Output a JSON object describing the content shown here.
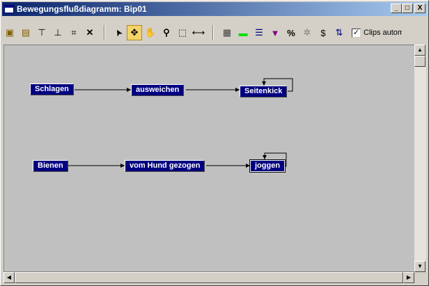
{
  "window": {
    "title": "Bewegungsflußdiagramm: Bip01",
    "buttons": [
      "_",
      "□",
      "X"
    ]
  },
  "toolbar": {
    "tools": [
      {
        "name": "new-layer-icon",
        "glyph": "▣"
      },
      {
        "name": "open-file-icon",
        "glyph": "▤"
      },
      {
        "name": "insert-transition-icon",
        "glyph": "⊤"
      },
      {
        "name": "insert-clip-icon",
        "glyph": "⊥"
      },
      {
        "name": "link-icon",
        "glyph": "⌗"
      },
      {
        "name": "delete-icon",
        "glyph": "✕"
      },
      {
        "name": "select-arrow-icon",
        "glyph": "➤"
      },
      {
        "name": "move-icon",
        "glyph": "✥"
      },
      {
        "name": "pan-hand-icon",
        "glyph": "✋"
      },
      {
        "name": "zoom-icon",
        "glyph": "⚲"
      },
      {
        "name": "zoom-region-icon",
        "glyph": "⬚"
      },
      {
        "name": "zoom-extents-icon",
        "glyph": "⟷"
      },
      {
        "name": "save-icon",
        "glyph": "▦"
      },
      {
        "name": "green-clip-icon",
        "glyph": "▬"
      },
      {
        "name": "list-icon",
        "glyph": "☰"
      },
      {
        "name": "purple-select-icon",
        "glyph": "▼"
      },
      {
        "name": "percent-icon",
        "glyph": "%"
      },
      {
        "name": "settings-icon",
        "glyph": "✲"
      },
      {
        "name": "dollar-icon",
        "glyph": "$"
      },
      {
        "name": "random-icon",
        "glyph": "⇅"
      }
    ],
    "clips_checkbox": {
      "checked": "✓",
      "label": "Clips autom. b"
    }
  },
  "diagram": {
    "nodes": [
      {
        "id": "schlagen",
        "label": "Schlagen"
      },
      {
        "id": "ausweichen",
        "label": "ausweichen"
      },
      {
        "id": "seitenkick",
        "label": "Seitenkick"
      },
      {
        "id": "bienen",
        "label": "Bienen"
      },
      {
        "id": "hund",
        "label": "vom Hund gezogen"
      },
      {
        "id": "joggen",
        "label": "joggen"
      }
    ]
  },
  "scrollbars": {
    "up": "▲",
    "down": "▼",
    "left": "◀",
    "right": "▶"
  }
}
